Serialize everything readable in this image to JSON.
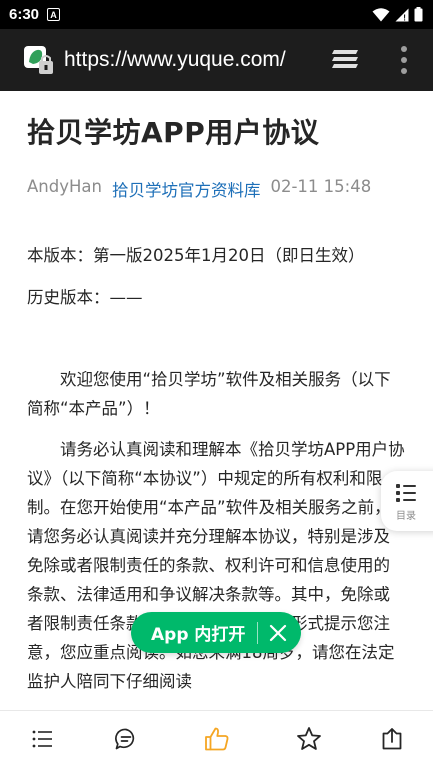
{
  "status_bar": {
    "time": "6:30",
    "notification_letter": "A"
  },
  "browser": {
    "url": "https://www.yuque.com/"
  },
  "article": {
    "title": "拾贝学坊APP用户协议",
    "author": "AndyHan",
    "group": "拾贝学坊官方资料库",
    "datetime": "02-11 15:48",
    "paragraphs": [
      "本版本：第一版2025年1月20日（即日生效）",
      "历史版本：——",
      "欢迎您使用“拾贝学坊”软件及相关服务（以下简称“本产品”）！",
      "请务必认真阅读和理解本《拾贝学坊APP用户协议》（以下简称“本协议”）中规定的所有权利和限制。在您开始使用“本产品”软件及相关服务之前，请您务必认真阅读并充分理解本协议，特别是涉及免除或者限制责任的条款、权利许可和信息使用的条款、法律适用和争议解决条款等。其中，免除或者限制责任条款等重要内容将以加粗形式提示您注意，您应重点阅读。如您未满18周岁，请您在法定监护人陪同下仔细阅读"
    ]
  },
  "toc": {
    "label": "目录"
  },
  "app_open": {
    "label": "App 内打开"
  },
  "colors": {
    "accent_green": "#00b96b",
    "link_blue": "#1d6fb8",
    "like_orange": "#f5a623"
  }
}
